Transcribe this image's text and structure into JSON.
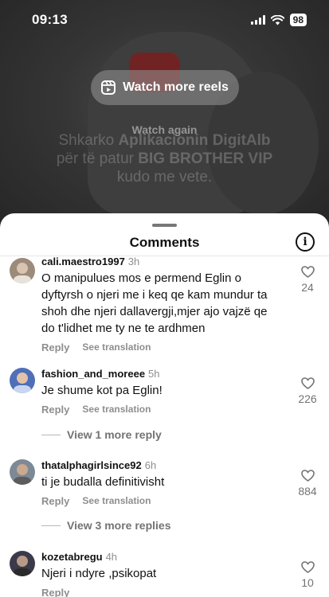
{
  "status_bar": {
    "time": "09:13",
    "battery": "98"
  },
  "video": {
    "reels_button_label": "Watch more reels",
    "watch_again_label": "Watch again",
    "promo_line1_prefix": "Shkarko ",
    "promo_line1_bold": "Aplikacionin DigitAlb",
    "promo_line2_prefix": "për të patur ",
    "promo_line2_bold": "BIG BROTHER VIP",
    "promo_line3": "kudo me vete."
  },
  "sheet": {
    "title": "Comments",
    "info_icon": "info-icon"
  },
  "comments": [
    {
      "username": "cali.maestro1997",
      "time": "3h",
      "text": "O manipulues mos e permend Eglin o dyftyrsh o njeri me i keq qe kam mundur ta shoh dhe njeri dallavergji,mjer ajo vajzë qe do t'lidhet me ty ne te ardhmen",
      "reply_label": "Reply",
      "translate_label": "See translation",
      "likes": "24",
      "avatar_color": "#9c8a7a"
    },
    {
      "username": "fashion_and_moreee",
      "time": "5h",
      "text": "Je shume kot pa Eglin!",
      "reply_label": "Reply",
      "translate_label": "See translation",
      "likes": "226",
      "more_replies": "View 1 more reply",
      "avatar_color": "#4f6fb8"
    },
    {
      "username": "thatalphagirlsince92",
      "time": "6h",
      "text": "ti je budalla definitivisht",
      "reply_label": "Reply",
      "translate_label": "See translation",
      "likes": "884",
      "more_replies": "View 3 more replies",
      "avatar_color": "#7d8a96"
    },
    {
      "username": "kozetabregu",
      "time": "4h",
      "text": "Njeri i ndyre ,psikopat",
      "reply_label": "Reply",
      "likes": "10",
      "avatar_color": "#3a3a4a"
    }
  ]
}
